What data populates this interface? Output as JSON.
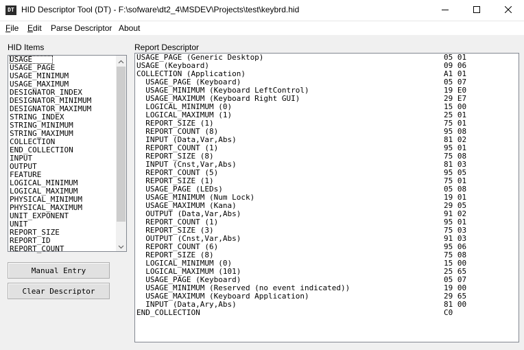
{
  "window": {
    "icon_label": "DT",
    "title": "HID Descriptor Tool (DT) - F:\\sofware\\dt2_4\\MSDEV\\Projects\\test\\keybrd.hid",
    "minimize_icon": "minimize-icon",
    "maximize_icon": "maximize-icon",
    "close_icon": "close-icon"
  },
  "menu": [
    {
      "underline": "F",
      "rest": "ile"
    },
    {
      "underline": "E",
      "rest": "dit"
    },
    {
      "underline": "",
      "rest": "Parse Descriptor"
    },
    {
      "underline": "",
      "rest": "About"
    }
  ],
  "hid_items": {
    "label": "HID Items",
    "items": [
      "USAGE",
      "USAGE_PAGE",
      "USAGE_MINIMUM",
      "USAGE_MAXIMUM",
      "DESIGNATOR_INDEX",
      "DESIGNATOR_MINIMUM",
      "DESIGNATOR_MAXIMUM",
      "STRING_INDEX",
      "STRING_MINIMUM",
      "STRING_MAXIMUM",
      "COLLECTION",
      "END_COLLECTION",
      "INPUT",
      "OUTPUT",
      "FEATURE",
      "LOGICAL_MINIMUM",
      "LOGICAL_MAXIMUM",
      "PHYSICAL_MINIMUM",
      "PHYSICAL_MAXIMUM",
      "UNIT_EXPONENT",
      "UNIT",
      "REPORT_SIZE",
      "REPORT_ID",
      "REPORT_COUNT"
    ],
    "selected": "USAGE"
  },
  "buttons": {
    "manual_entry": "Manual Entry",
    "clear_descriptor": "Clear Descriptor"
  },
  "report_descriptor": {
    "label": "Report Descriptor",
    "lines": [
      {
        "text": "USAGE_PAGE (Generic Desktop)",
        "bytes": "05 01"
      },
      {
        "text": "USAGE (Keyboard)",
        "bytes": "09 06"
      },
      {
        "text": "COLLECTION (Application)",
        "bytes": "A1 01"
      },
      {
        "text": "  USAGE_PAGE (Keyboard)",
        "bytes": "05 07"
      },
      {
        "text": "  USAGE_MINIMUM (Keyboard LeftControl)",
        "bytes": "19 E0"
      },
      {
        "text": "  USAGE_MAXIMUM (Keyboard Right GUI)",
        "bytes": "29 E7"
      },
      {
        "text": "  LOGICAL_MINIMUM (0)",
        "bytes": "15 00"
      },
      {
        "text": "  LOGICAL_MAXIMUM (1)",
        "bytes": "25 01"
      },
      {
        "text": "  REPORT_SIZE (1)",
        "bytes": "75 01"
      },
      {
        "text": "  REPORT_COUNT (8)",
        "bytes": "95 08"
      },
      {
        "text": "  INPUT (Data,Var,Abs)",
        "bytes": "81 02"
      },
      {
        "text": "  REPORT_COUNT (1)",
        "bytes": "95 01"
      },
      {
        "text": "  REPORT_SIZE (8)",
        "bytes": "75 08"
      },
      {
        "text": "  INPUT (Cnst,Var,Abs)",
        "bytes": "81 03"
      },
      {
        "text": "  REPORT_COUNT (5)",
        "bytes": "95 05"
      },
      {
        "text": "  REPORT_SIZE (1)",
        "bytes": "75 01"
      },
      {
        "text": "  USAGE_PAGE (LEDs)",
        "bytes": "05 08"
      },
      {
        "text": "  USAGE_MINIMUM (Num Lock)",
        "bytes": "19 01"
      },
      {
        "text": "  USAGE_MAXIMUM (Kana)",
        "bytes": "29 05"
      },
      {
        "text": "  OUTPUT (Data,Var,Abs)",
        "bytes": "91 02"
      },
      {
        "text": "  REPORT_COUNT (1)",
        "bytes": "95 01"
      },
      {
        "text": "  REPORT_SIZE (3)",
        "bytes": "75 03"
      },
      {
        "text": "  OUTPUT (Cnst,Var,Abs)",
        "bytes": "91 03"
      },
      {
        "text": "  REPORT_COUNT (6)",
        "bytes": "95 06"
      },
      {
        "text": "  REPORT_SIZE (8)",
        "bytes": "75 08"
      },
      {
        "text": "  LOGICAL_MINIMUM (0)",
        "bytes": "15 00"
      },
      {
        "text": "  LOGICAL_MAXIMUM (101)",
        "bytes": "25 65"
      },
      {
        "text": "  USAGE_PAGE (Keyboard)",
        "bytes": "05 07"
      },
      {
        "text": "  USAGE_MINIMUM (Reserved (no event indicated))",
        "bytes": "19 00"
      },
      {
        "text": "  USAGE_MAXIMUM (Keyboard Application)",
        "bytes": "29 65"
      },
      {
        "text": "  INPUT (Data,Ary,Abs)",
        "bytes": "81 00"
      },
      {
        "text": "END_COLLECTION",
        "bytes": "C0"
      }
    ]
  }
}
